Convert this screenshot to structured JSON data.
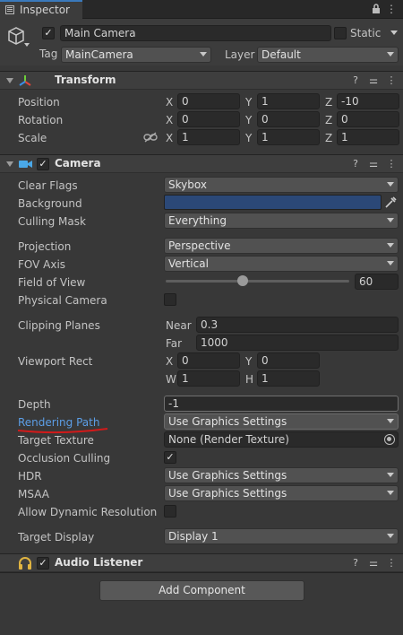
{
  "window": {
    "tab_label": "Inspector"
  },
  "gameobject": {
    "active": true,
    "name": "Main Camera",
    "static_label": "Static",
    "static_checked": false,
    "tag_label": "Tag",
    "tag_value": "MainCamera",
    "layer_label": "Layer",
    "layer_value": "Default"
  },
  "transform": {
    "title": "Transform",
    "rows": [
      {
        "label": "Position",
        "x": "0",
        "y": "1",
        "z": "-10"
      },
      {
        "label": "Rotation",
        "x": "0",
        "y": "0",
        "z": "0"
      },
      {
        "label": "Scale",
        "x": "1",
        "y": "1",
        "z": "1"
      }
    ],
    "axis_x": "X",
    "axis_y": "Y",
    "axis_z": "Z"
  },
  "camera": {
    "title": "Camera",
    "enabled": true,
    "clear_flags": {
      "label": "Clear Flags",
      "value": "Skybox"
    },
    "background": {
      "label": "Background",
      "color": "#2b4877"
    },
    "culling_mask": {
      "label": "Culling Mask",
      "value": "Everything"
    },
    "projection": {
      "label": "Projection",
      "value": "Perspective"
    },
    "fov_axis": {
      "label": "FOV Axis",
      "value": "Vertical"
    },
    "field_of_view": {
      "label": "Field of View",
      "value": "60",
      "slider_fraction": 0.42
    },
    "physical_camera": {
      "label": "Physical Camera",
      "checked": false
    },
    "clipping_planes": {
      "label": "Clipping Planes",
      "near_label": "Near",
      "near": "0.3",
      "far_label": "Far",
      "far": "1000"
    },
    "viewport_rect": {
      "label": "Viewport Rect",
      "x_label": "X",
      "x": "0",
      "y_label": "Y",
      "y": "0",
      "w_label": "W",
      "w": "1",
      "h_label": "H",
      "h": "1"
    },
    "depth": {
      "label": "Depth",
      "value": "-1"
    },
    "rendering_path": {
      "label": "Rendering Path",
      "value": "Use Graphics Settings",
      "underline_color": "#d11a1a",
      "label_color": "#5c9ee6"
    },
    "target_texture": {
      "label": "Target Texture",
      "value": "None (Render Texture)"
    },
    "occlusion_culling": {
      "label": "Occlusion Culling",
      "checked": true
    },
    "hdr": {
      "label": "HDR",
      "value": "Use Graphics Settings"
    },
    "msaa": {
      "label": "MSAA",
      "value": "Use Graphics Settings"
    },
    "dynamic_resolution": {
      "label": "Allow Dynamic Resolution",
      "checked": false
    },
    "target_display": {
      "label": "Target Display",
      "value": "Display 1"
    }
  },
  "audio_listener": {
    "title": "Audio Listener",
    "enabled": true
  },
  "add_component_label": "Add Component",
  "icons": {
    "check": "✓",
    "help": "?",
    "settings": "⚌",
    "more": "⋮",
    "lock": "🔒",
    "picker": "⊙"
  }
}
